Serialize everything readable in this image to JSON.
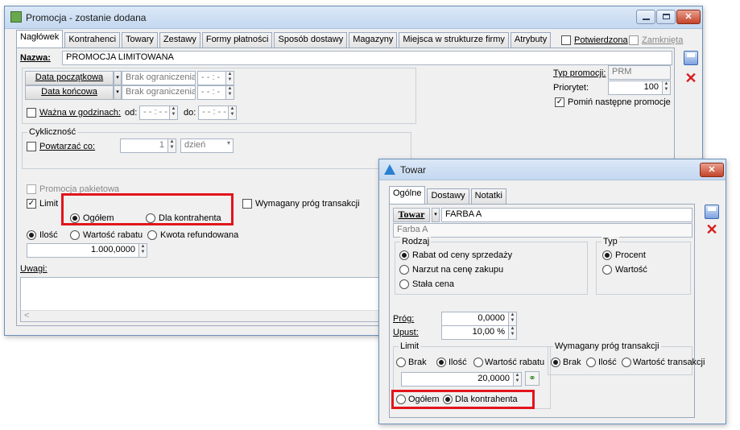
{
  "main": {
    "title": "Promocja - zostanie dodana",
    "tabs": [
      "Nagłówek",
      "Kontrahenci",
      "Towary",
      "Zestawy",
      "Formy płatności",
      "Sposób dostawy",
      "Magazyny",
      "Miejsca w strukturze firmy",
      "Atrybuty"
    ],
    "potwierdzona": "Potwierdzona",
    "zamknieta": "Zamknięta",
    "nazwa_label": "Nazwa:",
    "nazwa_value": "PROMOCJA LIMITOWANA",
    "data_poczatkowa": "Data początkowa",
    "data_koncowa": "Data końcowa",
    "brak_ogr_1": "Brak ograniczenia",
    "brak_ogr_2": "Brak ograniczenia",
    "time_placeholder": "- - : -",
    "wazna": "Ważna w godzinach:",
    "od": "od:",
    "do": "do:",
    "time_od": "- - : - -",
    "time_do": "- - : - -",
    "typ_label": "Typ promocji:",
    "typ_value": "PRM",
    "priorytet_label": "Priorytet:",
    "priorytet_value": "100",
    "pomin": "Pomiń następne promocje",
    "cyklicznosc": "Cykliczność",
    "powtarzac": "Powtarzać co:",
    "powtarzac_value": "1",
    "dzien": "dzień",
    "pakietowa": "Promocja pakietowa",
    "limit": "Limit",
    "wymagany": "Wymagany próg transakcji",
    "ogolem": "Ogółem",
    "dla_kontrahenta": "Dla kontrahenta",
    "ilosc": "Ilość",
    "wartosc_rabatu": "Wartość rabatu",
    "kwota_refundowana": "Kwota refundowana",
    "ilosc_value": "1.000,0000",
    "uwagi": "Uwagi:",
    "scroll_left": "<"
  },
  "towar": {
    "title": "Towar",
    "tabs": [
      "Ogólne",
      "Dostawy",
      "Notatki"
    ],
    "towar_btn": "Towar",
    "towar_code": "FARBA A",
    "towar_name": "Farba A",
    "rodzaj": "Rodzaj",
    "rabat": "Rabat od ceny sprzedaży",
    "narzut": "Narzut na cenę zakupu",
    "stala": "Stała cena",
    "typ": "Typ",
    "procent": "Procent",
    "wartosc": "Wartość",
    "prog_label": "Próg:",
    "prog_value": "0,0000",
    "upust_label": "Upust:",
    "upust_value": "10,00 %",
    "limit": "Limit",
    "brak": "Brak",
    "ilosc": "Ilość",
    "wartosc_rabatu": "Wartość rabatu",
    "limit_value": "20,0000",
    "wymagany": "Wymagany próg transakcji",
    "w_brak": "Brak",
    "w_ilosc": "Ilość",
    "w_wartosc": "Wartość transakcji",
    "ogolem": "Ogółem",
    "dla_kontrahenta": "Dla kontrahenta"
  }
}
